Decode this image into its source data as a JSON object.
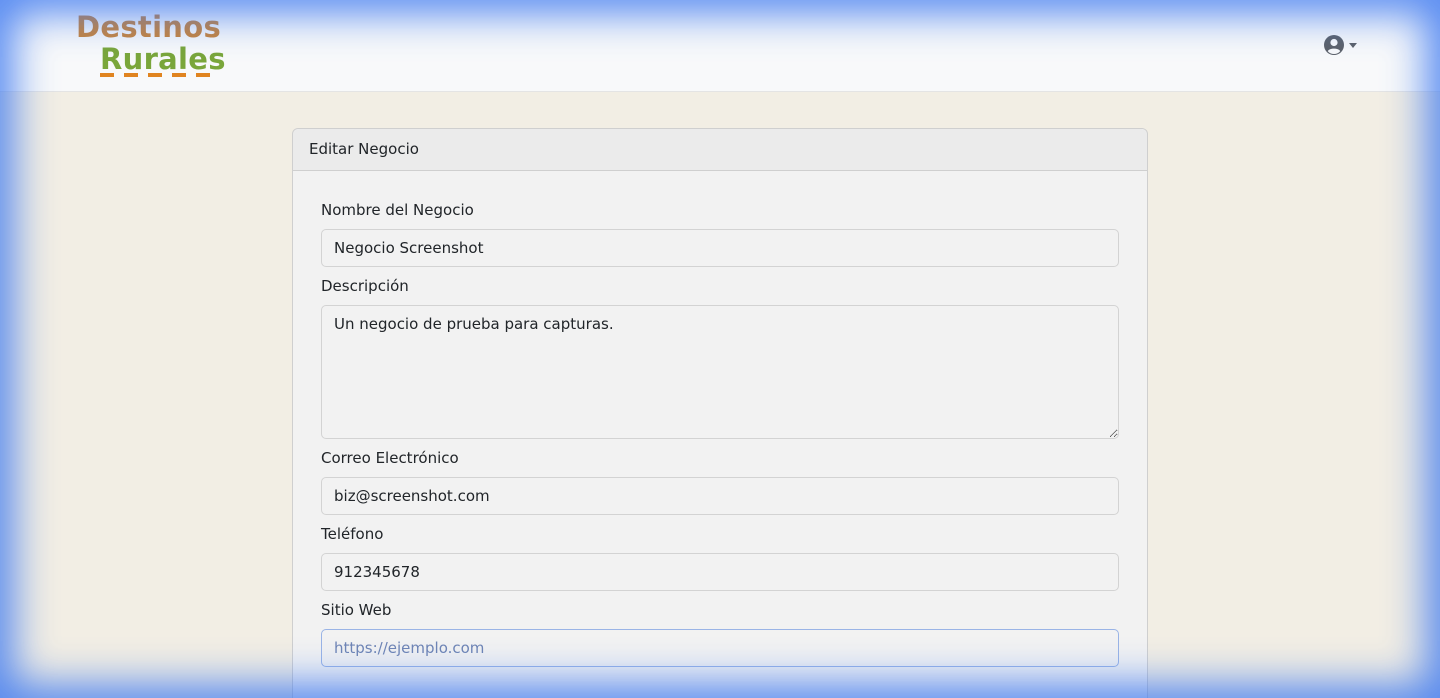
{
  "brand": {
    "line1": "Destinos",
    "line2": "Rurales",
    "colors": {
      "green": "#7aa63a",
      "orange": "#e08420",
      "brown": "#c9843a"
    }
  },
  "nav": {
    "user_icon": "user-circle-icon"
  },
  "card": {
    "title": "Editar Negocio",
    "fields": {
      "name": {
        "label": "Nombre del Negocio",
        "value": "Negocio Screenshot"
      },
      "description": {
        "label": "Descripción",
        "value": "Un negocio de prueba para capturas."
      },
      "email": {
        "label": "Correo Electrónico",
        "value": "biz@screenshot.com"
      },
      "phone": {
        "label": "Teléfono",
        "value": "912345678"
      },
      "website": {
        "label": "Sitio Web",
        "value": "",
        "placeholder": "https://ejemplo.com"
      }
    }
  }
}
